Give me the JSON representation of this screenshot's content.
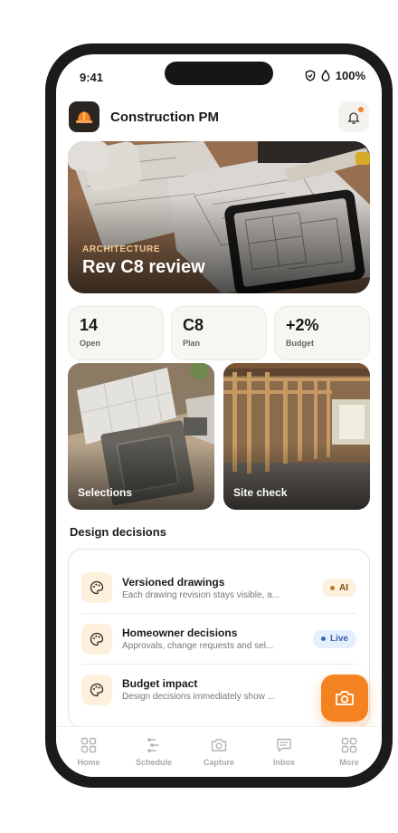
{
  "status": {
    "time": "9:41",
    "battery": "100%"
  },
  "app": {
    "title": "Construction PM"
  },
  "hero": {
    "eyebrow": "ARCHITECTURE",
    "title": "Rev C8 review"
  },
  "stats": [
    {
      "value": "14",
      "label": "Open"
    },
    {
      "value": "C8",
      "label": "Plan"
    },
    {
      "value": "+2%",
      "label": "Budget"
    }
  ],
  "tiles": [
    {
      "label": "Selections"
    },
    {
      "label": "Site check"
    }
  ],
  "section": {
    "title": "Design decisions"
  },
  "decisions": [
    {
      "title": "Versioned drawings",
      "subtitle": "Each drawing revision stays visible, a...",
      "badge": "AI"
    },
    {
      "title": "Homeowner decisions",
      "subtitle": "Approvals, change requests and sel...",
      "badge": "Live"
    },
    {
      "title": "Budget impact",
      "subtitle": "Design decisions immediately show ...",
      "badge": ""
    }
  ],
  "tabs": [
    {
      "label": "Home",
      "icon": "grid-icon"
    },
    {
      "label": "Schedule",
      "icon": "timeline-icon"
    },
    {
      "label": "Capture",
      "icon": "camera-icon"
    },
    {
      "label": "Inbox",
      "icon": "message-icon"
    },
    {
      "label": "More",
      "icon": "grid-icon"
    }
  ],
  "colors": {
    "accent": "#f58220",
    "live": "#3765b6"
  }
}
